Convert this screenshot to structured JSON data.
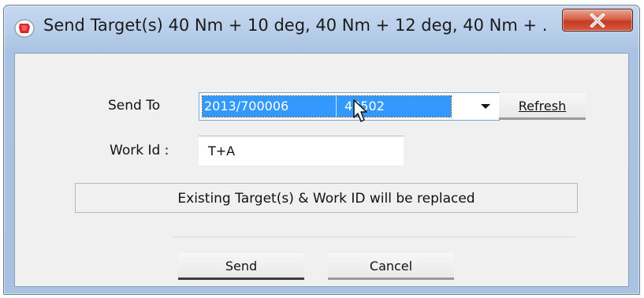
{
  "window": {
    "title": "Send Target(s) 40 Nm + 10 deg, 40 Nm + 12 deg, 40 Nm + ...",
    "icon": "app-icon",
    "close_icon": "close-icon",
    "accent_color": "#3399ff",
    "close_color": "#c43b22"
  },
  "form": {
    "send_to_label": "Send To",
    "send_to_selected": {
      "col1": "2013/700006",
      "col2": "43502"
    },
    "refresh_label": "Refresh",
    "work_id_label": "Work Id :",
    "work_id_value": "T+A",
    "status_message": "Existing Target(s) & Work ID will be replaced"
  },
  "actions": {
    "send_label": "Send",
    "cancel_label": "Cancel"
  }
}
